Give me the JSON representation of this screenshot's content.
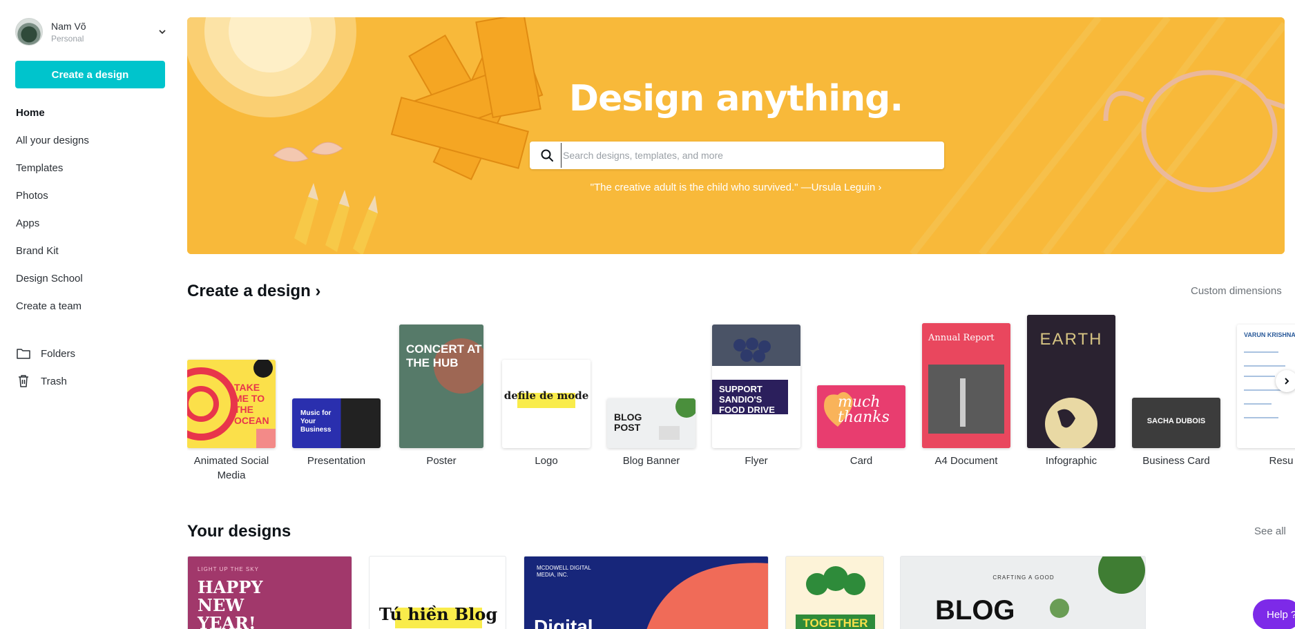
{
  "account": {
    "name": "Nam Võ",
    "plan": "Personal"
  },
  "sidebar": {
    "create_label": "Create a design",
    "nav": [
      "Home",
      "All your designs",
      "Templates",
      "Photos",
      "Apps",
      "Brand Kit",
      "Design School",
      "Create a team"
    ],
    "folders_label": "Folders",
    "trash_label": "Trash"
  },
  "hero": {
    "title": "Design anything.",
    "search_placeholder": "Search designs, templates, and more",
    "quote": "\"The creative adult is the child who survived.\" —Ursula Leguin ›"
  },
  "create_section": {
    "title": "Create a design ›",
    "custom_label": "Custom dimensions",
    "types": [
      {
        "label": "Animated Social Media",
        "thumb_text": "TAKE ME TO THE OCEAN"
      },
      {
        "label": "Presentation",
        "thumb_text": "Music for Your Business"
      },
      {
        "label": "Poster",
        "thumb_text": "CONCERT AT THE HUB"
      },
      {
        "label": "Logo",
        "thumb_text": "defile de mode"
      },
      {
        "label": "Blog Banner",
        "thumb_text": "BLOG POST"
      },
      {
        "label": "Flyer",
        "thumb_text": "SUPPORT SANDIO'S FOOD DRIVE"
      },
      {
        "label": "Card",
        "thumb_text": "much thanks"
      },
      {
        "label": "A4 Document",
        "thumb_text": "Annual Report"
      },
      {
        "label": "Infographic",
        "thumb_text": "EARTH"
      },
      {
        "label": "Business Card",
        "thumb_text": "SACHA DUBOIS"
      },
      {
        "label": "Resu",
        "thumb_text": "VARUN KRISHNAN"
      }
    ]
  },
  "your_designs": {
    "title": "Your designs",
    "see_all": "See all",
    "items": [
      {
        "small": "LIGHT UP THE SKY",
        "title": "HAPPY NEW YEAR!"
      },
      {
        "title": "Tú hiền Blog"
      },
      {
        "small": "MCDOWELL DIGITAL MEDIA, INC.",
        "title": "Digital"
      },
      {
        "title": "TOGETHER"
      },
      {
        "small": "CRAFTING A GOOD",
        "title": "BLOG"
      }
    ]
  },
  "help_label": "Help ?",
  "colors": {
    "accent": "#00c4cc",
    "hero_bg": "#f8b93a",
    "help": "#7d2ae8"
  }
}
